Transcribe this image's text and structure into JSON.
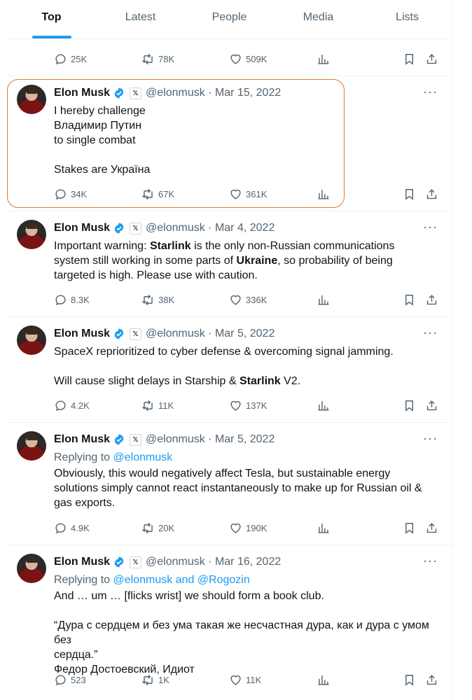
{
  "tabs": [
    {
      "label": "Top",
      "active": true
    },
    {
      "label": "Latest"
    },
    {
      "label": "People"
    },
    {
      "label": "Media"
    },
    {
      "label": "Lists"
    }
  ],
  "prev_tweet_actions": {
    "replies": "25K",
    "reposts": "78K",
    "likes": "509K"
  },
  "tweets": [
    {
      "name": "Elon Musk",
      "handle": "@elonmusk",
      "date": "Mar 15, 2022",
      "replies": "34K",
      "reposts": "67K",
      "likes": "361K",
      "lines": [
        "I hereby challenge",
        "Владимир Путин",
        "to single combat",
        "",
        "Stakes are Україна"
      ]
    },
    {
      "name": "Elon Musk",
      "handle": "@elonmusk",
      "date": "Mar 4, 2022",
      "replies": "8.3K",
      "reposts": "38K",
      "likes": "336K",
      "line1_a": "Important warning: ",
      "line1_b": "Starlink",
      "line1_c": " is the only non-Russian communications",
      "line2_a": "system still working in some parts of ",
      "line2_b": "Ukraine",
      "line2_c": ", so probability of being",
      "line3": "targeted is high. Please use with caution."
    },
    {
      "name": "Elon Musk",
      "handle": "@elonmusk",
      "date": "Mar 5, 2022",
      "replies": "4.2K",
      "reposts": "11K",
      "likes": "137K",
      "line1": "SpaceX reprioritized to cyber defense & overcoming signal jamming.",
      "line3_a": "Will cause slight delays in Starship & ",
      "line3_b": "Starlink",
      "line3_c": " V2."
    },
    {
      "name": "Elon Musk",
      "handle": "@elonmusk",
      "date": "Mar 5, 2022",
      "replies": "4.9K",
      "reposts": "20K",
      "likes": "190K",
      "replying_prefix": "Replying to ",
      "replying_to": "@elonmusk",
      "lines": [
        "Obviously, this would negatively affect Tesla, but sustainable energy",
        "solutions simply cannot react instantaneously to make up for Russian oil &",
        "gas exports."
      ]
    },
    {
      "name": "Elon Musk",
      "handle": "@elonmusk",
      "date": "Mar 16, 2022",
      "replies": "523",
      "reposts": "1K",
      "likes": "11K",
      "replying_prefix": "Replying to ",
      "replying_to": "@elonmusk and @Rogozin",
      "lines": [
        "And … um … [flicks wrist] we should form a book club.",
        "",
        "“Дура с сердцем и без ума такая же несчастная дура, как и дура с умом без",
        "сердца.”",
        "Федор Достоевский, Идиот"
      ]
    }
  ],
  "colors": {
    "accent": "#1d9bf0",
    "secondary": "#536471",
    "highlight": "#e07b28"
  }
}
